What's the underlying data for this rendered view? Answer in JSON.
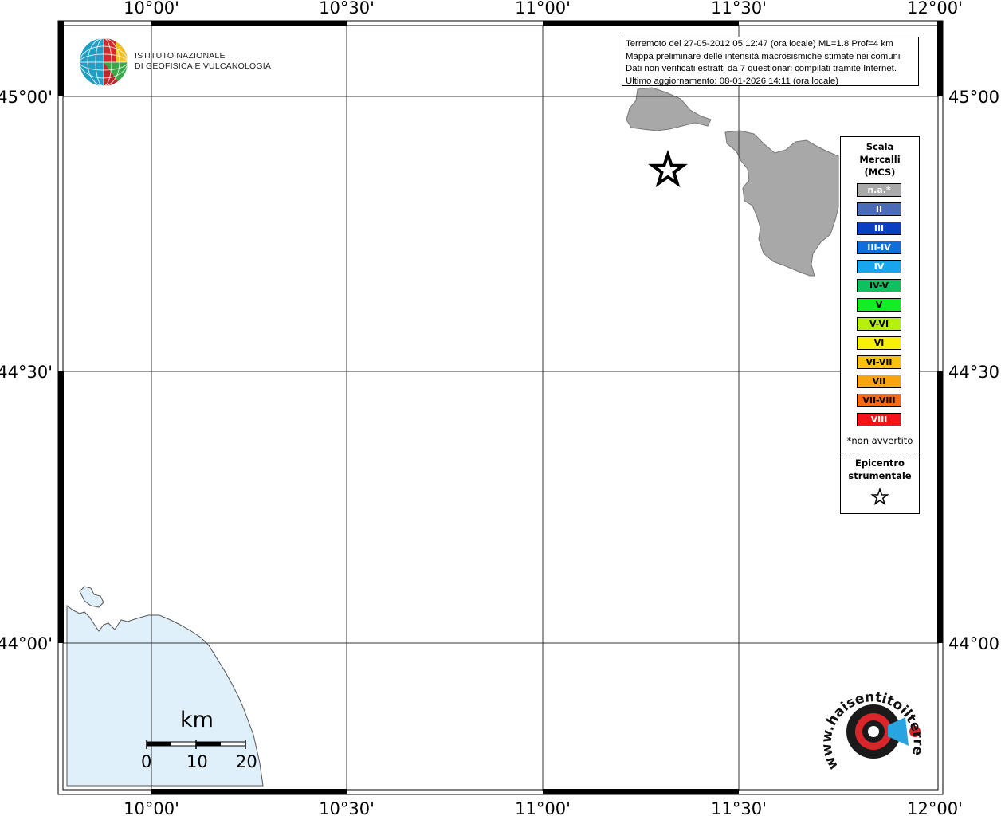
{
  "map": {
    "top_longitudes": [
      "10°00'",
      "10°30'",
      "11°00'",
      "11°30'",
      "12°00'"
    ],
    "bottom_longitudes": [
      "10°00'",
      "10°30'",
      "11°00'",
      "11°30'",
      "12°00'"
    ],
    "left_latitudes": [
      "45°00'",
      "44°30'",
      "44°00'"
    ],
    "right_latitudes": [
      "45°00'",
      "44°30'",
      "44°00'"
    ],
    "colors": {
      "sea": "#dff0fb",
      "municipality": "#a8a8a8",
      "frame": "#000000",
      "grid": "#333333"
    }
  },
  "info": {
    "line1": "Terremoto del 27-05-2012 05:12:47 (ora locale) ML=1.8 Prof=4 km",
    "line2": "Mappa preliminare delle intensità macrosismiche stimate nei comuni",
    "line3": "Dati non verificati estratti da 7 questionari compilati tramite Internet.",
    "line4": "Ultimo aggiornamento: 08-01-2026 14:11 (ora locale)"
  },
  "ingv": {
    "line1": "ISTITUTO NAZIONALE",
    "line2": "DI GEOFISICA E VULCANOLOGIA"
  },
  "legend": {
    "title1": "Scala",
    "title2": "Mercalli",
    "title3": "(MCS)",
    "items": [
      {
        "label": "n.a.*",
        "color": "#a9a9a9",
        "text": "#ffffff"
      },
      {
        "label": "II",
        "color": "#4a6bb8",
        "text": "#ffffff"
      },
      {
        "label": "III",
        "color": "#0a3fc4",
        "text": "#ffffff"
      },
      {
        "label": "III-IV",
        "color": "#0e6fdc",
        "text": "#ffffff"
      },
      {
        "label": "IV",
        "color": "#17a6ee",
        "text": "#ffffff"
      },
      {
        "label": "IV-V",
        "color": "#0fc060",
        "text": "#000000"
      },
      {
        "label": "V",
        "color": "#12ee24",
        "text": "#000000"
      },
      {
        "label": "V-VI",
        "color": "#b6f00e",
        "text": "#000000"
      },
      {
        "label": "VI",
        "color": "#f6f00a",
        "text": "#000000"
      },
      {
        "label": "VI-VII",
        "color": "#f6c20d",
        "text": "#000000"
      },
      {
        "label": "VII",
        "color": "#f9a40e",
        "text": "#000000"
      },
      {
        "label": "VII-VIII",
        "color": "#f96a12",
        "text": "#000000"
      },
      {
        "label": "VIII",
        "color": "#f2141a",
        "text": "#ffffff"
      }
    ],
    "note": "*non avvertito",
    "epicenter1": "Epicentro",
    "epicenter2": "strumentale"
  },
  "scale": {
    "title": "km",
    "labels": [
      "0",
      "10",
      "20"
    ]
  },
  "website": {
    "text": "www.haisentitoilterremoto.it"
  }
}
